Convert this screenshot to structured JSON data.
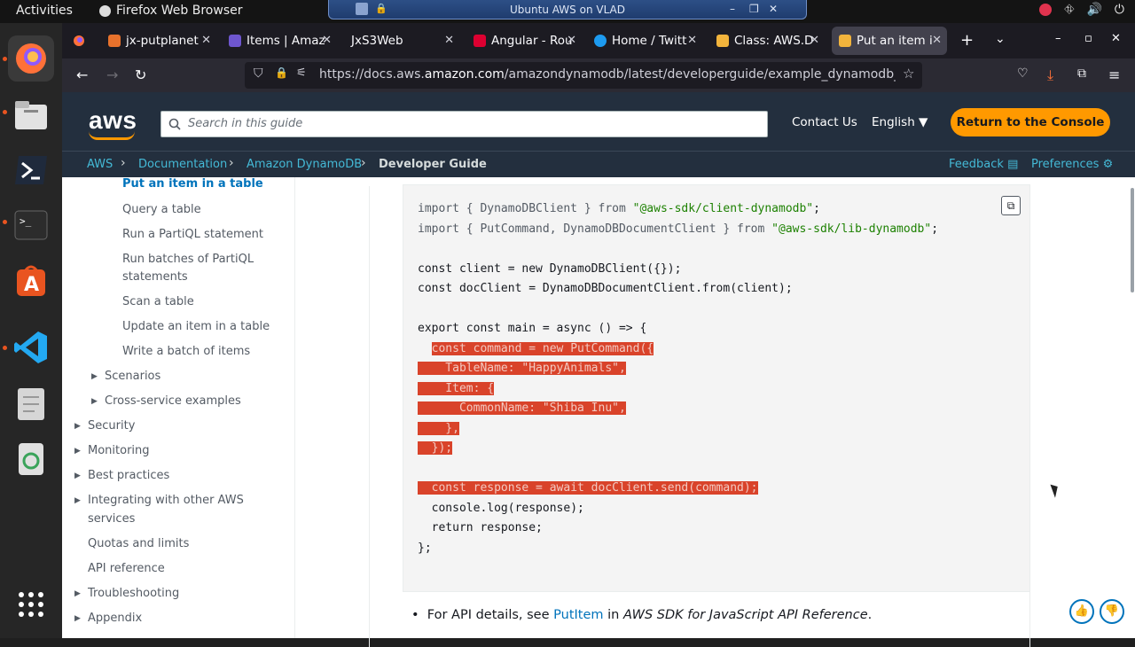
{
  "system": {
    "activities": "Activities",
    "app_name": "Firefox Web Browser",
    "vm_title": "Ubuntu AWS on VLAD"
  },
  "browser": {
    "tabs": [
      {
        "label": "jx-putplanet",
        "favicon_color": "#e8722c"
      },
      {
        "label": "Items | Amaz",
        "favicon_color": "#6e56cf"
      },
      {
        "label": "JxS3Web",
        "favicon_color": ""
      },
      {
        "label": "Angular - Rou",
        "favicon_color": "#dd0031"
      },
      {
        "label": "Home / Twitt",
        "favicon_color": "#1d9bf0"
      },
      {
        "label": "Class: AWS.D",
        "favicon_color": "#f2b43c"
      },
      {
        "label": "Put an item i",
        "favicon_color": "#f2b43c"
      }
    ],
    "url_prefix": "https://docs.aws.",
    "url_domain": "amazon.com",
    "url_path": "/amazondynamodb/latest/developerguide/example_dynamodb_PutI"
  },
  "header": {
    "logo": "aws",
    "search_placeholder": "Search in this guide",
    "contact": "Contact Us",
    "language": "English",
    "return_button": "Return to the Console"
  },
  "breadcrumb": {
    "items": [
      "AWS",
      "Documentation",
      "Amazon DynamoDB"
    ],
    "current": "Developer Guide",
    "feedback": "Feedback",
    "preferences": "Preferences"
  },
  "leftnav": {
    "active": "Put an item in a table",
    "sub_items": [
      "Query a table",
      "Run a PartiQL statement",
      "Run batches of PartiQL",
      "statements",
      "Scan a table",
      "Update an item in a table",
      "Write a batch of items"
    ],
    "scenarios": "Scenarios",
    "cross_service": "Cross-service examples",
    "top_items": [
      "Security",
      "Monitoring",
      "Best practices",
      "Integrating with other AWS",
      "services",
      "Quotas and limits",
      "API reference",
      "Troubleshooting",
      "Appendix"
    ]
  },
  "code": {
    "line1_a": "import { DynamoDBClient } from ",
    "line1_b": "\"@aws-sdk/client-dynamodb\"",
    "line1_c": ";",
    "line2_a": "import { PutCommand, DynamoDBDocumentClient } from ",
    "line2_b": "\"@aws-sdk/lib-dynamodb\"",
    "line2_c": ";",
    "line3": "const client = new DynamoDBClient({});",
    "line4": "const docClient = DynamoDBDocumentClient.from(client);",
    "line5": "export const main = async () => {",
    "line6": "const command = new PutCommand({",
    "line7": "  TableName: \"HappyAnimals\",",
    "line8": "  Item: {",
    "line9": "    CommonName: \"Shiba Inu\",",
    "line10": "  },",
    "line11": "});",
    "line12": "const response = await docClient.send(command);",
    "line13": "console.log(response);",
    "line14": "return response;",
    "line15": "};"
  },
  "note": {
    "prefix": "For API details, see ",
    "link": "PutItem",
    "middle": " in ",
    "ref": "AWS SDK for JavaScript API Reference",
    "suffix": "."
  }
}
